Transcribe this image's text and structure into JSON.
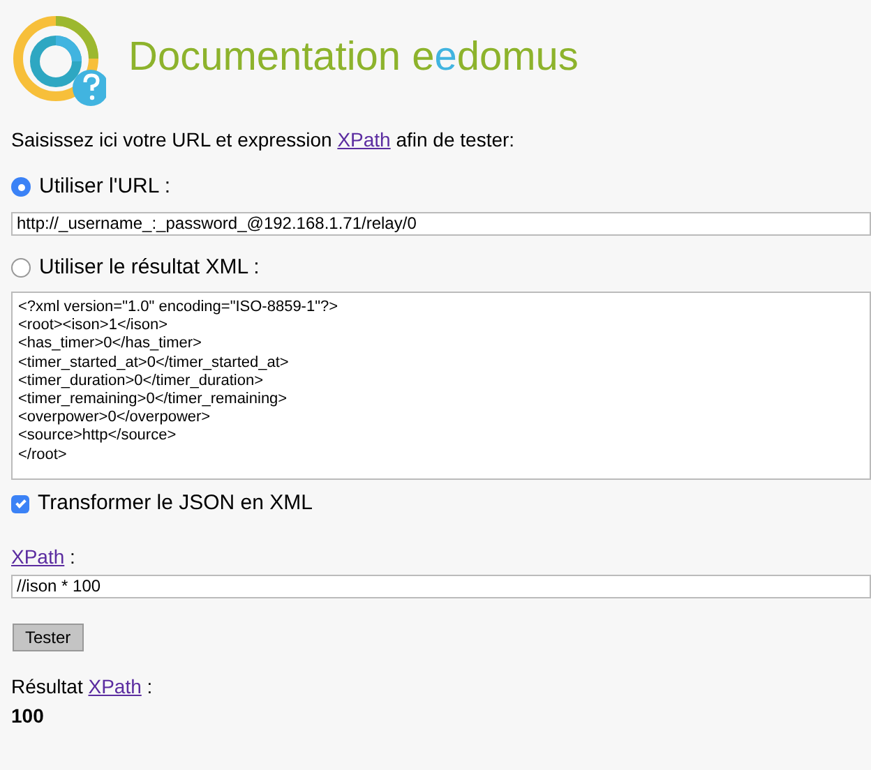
{
  "header": {
    "title_parts": [
      {
        "text": "Documentation e",
        "color": "#8db32c"
      },
      {
        "text": "e",
        "color": "#41b4e0"
      },
      {
        "text": "domus",
        "color": "#8db32c"
      }
    ]
  },
  "intro": {
    "before": "Saisissez ici votre URL et expression ",
    "link": "XPath",
    "after": " afin de tester:"
  },
  "sources": [
    {
      "kind": "url",
      "label": "Utiliser l'URL :",
      "selected": true,
      "value": "http://_username_:_password_@192.168.1.71/relay/0"
    },
    {
      "kind": "xml",
      "label": "Utiliser le résultat XML :",
      "selected": false,
      "value": "<?xml version=\"1.0\" encoding=\"ISO-8859-1\"?>\n<root><ison>1</ison>\n<has_timer>0</has_timer>\n<timer_started_at>0</timer_started_at>\n<timer_duration>0</timer_duration>\n<timer_remaining>0</timer_remaining>\n<overpower>0</overpower>\n<source>http</source>\n</root>"
    }
  ],
  "json_to_xml": {
    "label": "Transformer le JSON en XML",
    "checked": true
  },
  "xpath": {
    "link": "XPath",
    "after": " :",
    "value": "//ison * 100"
  },
  "submit": "Tester",
  "result": {
    "before": "Résultat ",
    "link": "XPath",
    "after": " :",
    "value": "100"
  }
}
